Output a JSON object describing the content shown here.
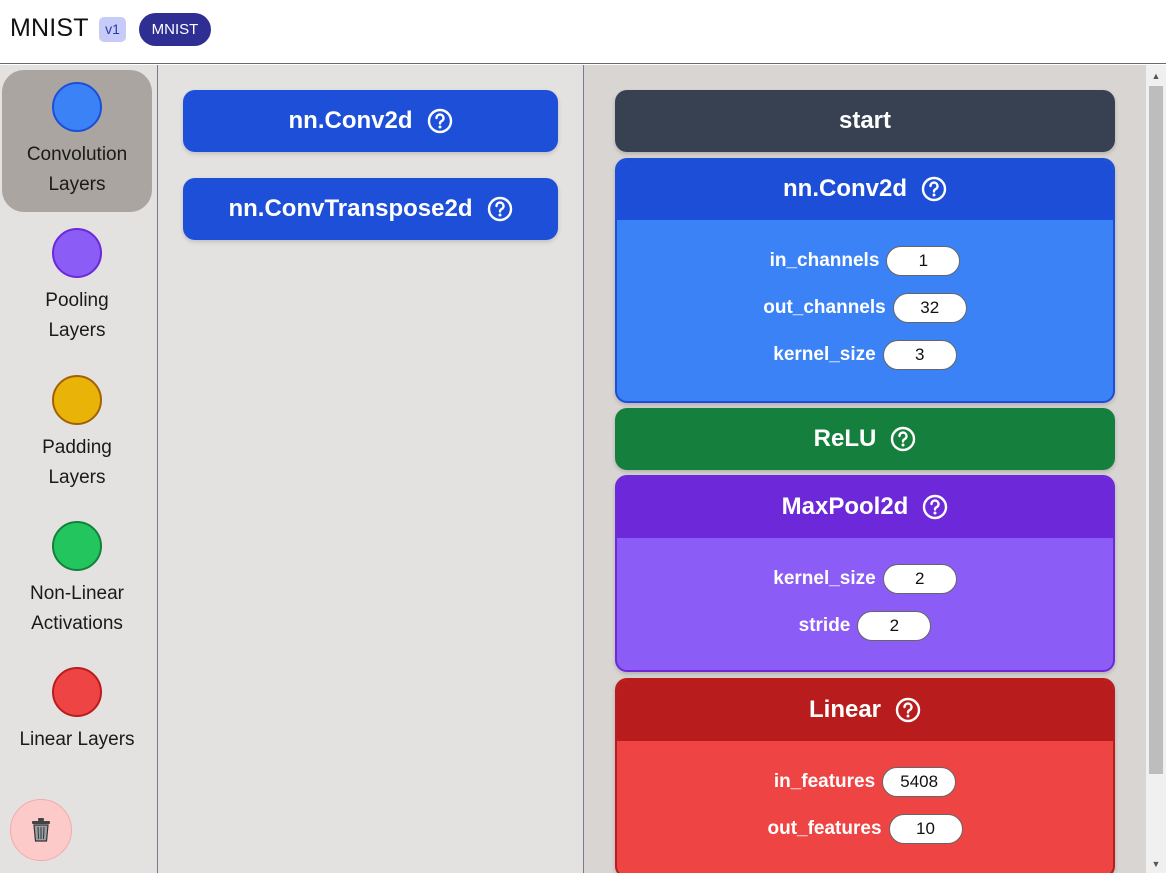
{
  "header": {
    "title": "MNIST",
    "version": "v1",
    "dataset": "MNIST"
  },
  "sidebar": {
    "categories": [
      {
        "label_line1": "Convolution",
        "label_line2": "Layers",
        "color": "#3b82f6",
        "border": "#1d4ed8",
        "active": true
      },
      {
        "label_line1": "Pooling",
        "label_line2": "Layers",
        "color": "#8b5cf6",
        "border": "#6d28d9",
        "active": false
      },
      {
        "label_line1": "Padding",
        "label_line2": "Layers",
        "color": "#eab308",
        "border": "#a16207",
        "active": false
      },
      {
        "label_line1": "Non-Linear",
        "label_line2": "Activations",
        "color": "#22c55e",
        "border": "#15803d",
        "active": false
      },
      {
        "label_line1": "Linear Layers",
        "label_line2": "",
        "color": "#ef4444",
        "border": "#b91c1c",
        "active": false
      }
    ],
    "trash_icon": "trash-icon"
  },
  "palette": {
    "items": [
      {
        "label": "nn.Conv2d"
      },
      {
        "label": "nn.ConvTranspose2d"
      }
    ]
  },
  "canvas": {
    "start_label": "start",
    "blocks": [
      {
        "title": "nn.Conv2d",
        "head_color": "#1d4ed8",
        "body_color": "#3b82f6",
        "params": [
          {
            "label": "in_channels",
            "value": "1"
          },
          {
            "label": "out_channels",
            "value": "32"
          },
          {
            "label": "kernel_size",
            "value": "3"
          }
        ]
      },
      {
        "title": "ReLU",
        "head_color": "#15803d",
        "params": []
      },
      {
        "title": "MaxPool2d",
        "head_color": "#6d28d9",
        "body_color": "#8b5cf6",
        "params": [
          {
            "label": "kernel_size",
            "value": "2"
          },
          {
            "label": "stride",
            "value": "2"
          }
        ]
      },
      {
        "title": "Linear",
        "head_color": "#b91c1c",
        "body_color": "#ef4444",
        "params": [
          {
            "label": "in_features",
            "value": "5408"
          },
          {
            "label": "out_features",
            "value": "10"
          }
        ]
      }
    ]
  }
}
